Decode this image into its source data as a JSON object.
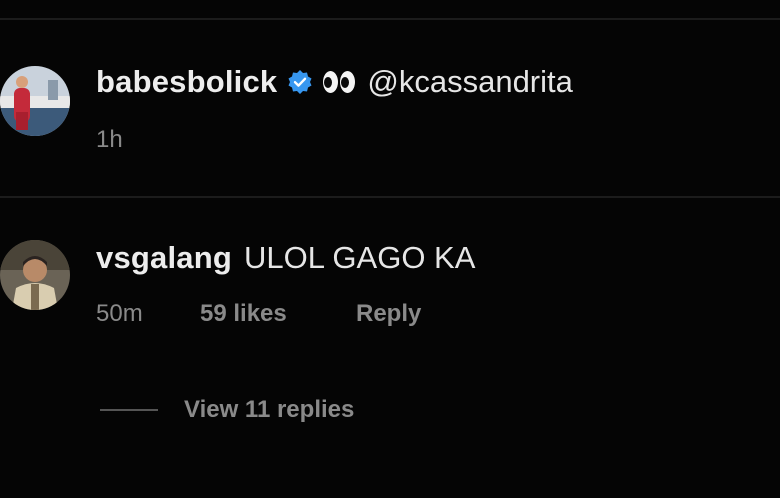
{
  "comments": [
    {
      "username": "babesbolick",
      "verified": true,
      "emoji": "eyes",
      "text": "@kcassandrita",
      "time": "1h",
      "avatar_icon": "profile-photo-woman-red-dress"
    },
    {
      "username": "vsgalang",
      "text": "ULOL GAGO KA",
      "time": "50m",
      "likes": "59 likes",
      "reply_label": "Reply",
      "avatar_icon": "profile-photo-man"
    }
  ],
  "replies": {
    "label": "View 11 replies"
  },
  "colors": {
    "background": "#050505",
    "text": "#e8e8e8",
    "meta": "#8a8a8a",
    "verified": "#3797f0"
  }
}
